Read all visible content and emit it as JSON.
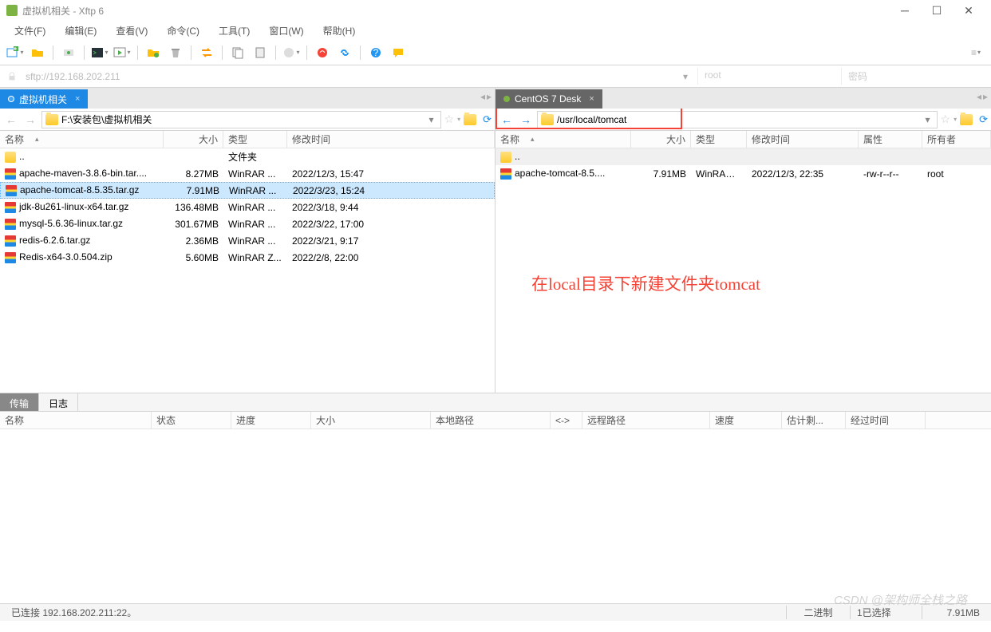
{
  "title": "虚拟机相关 - Xftp 6",
  "menus": [
    "文件(F)",
    "编辑(E)",
    "查看(V)",
    "命令(C)",
    "工具(T)",
    "窗口(W)",
    "帮助(H)"
  ],
  "address": {
    "url": "sftp://192.168.202.211",
    "user": "root",
    "password_placeholder": "密码"
  },
  "left": {
    "tab": "虚拟机相关",
    "path": "F:\\安装包\\虚拟机相关",
    "headers": {
      "name": "名称",
      "size": "大小",
      "type": "类型",
      "mtime": "修改时间"
    },
    "parent": {
      "name": "..",
      "type": "文件夹"
    },
    "rows": [
      {
        "name": "apache-maven-3.8.6-bin.tar....",
        "size": "8.27MB",
        "type": "WinRAR ...",
        "mtime": "2022/12/3, 15:47",
        "icon": "archive"
      },
      {
        "name": "apache-tomcat-8.5.35.tar.gz",
        "size": "7.91MB",
        "type": "WinRAR ...",
        "mtime": "2022/3/23, 15:24",
        "icon": "archive",
        "selected": true
      },
      {
        "name": "jdk-8u261-linux-x64.tar.gz",
        "size": "136.48MB",
        "type": "WinRAR ...",
        "mtime": "2022/3/18, 9:44",
        "icon": "archive"
      },
      {
        "name": "mysql-5.6.36-linux.tar.gz",
        "size": "301.67MB",
        "type": "WinRAR ...",
        "mtime": "2022/3/22, 17:00",
        "icon": "archive"
      },
      {
        "name": "redis-6.2.6.tar.gz",
        "size": "2.36MB",
        "type": "WinRAR ...",
        "mtime": "2022/3/21, 9:17",
        "icon": "archive"
      },
      {
        "name": "Redis-x64-3.0.504.zip",
        "size": "5.60MB",
        "type": "WinRAR Z...",
        "mtime": "2022/2/8, 22:00",
        "icon": "zip"
      }
    ]
  },
  "right": {
    "tab": "CentOS 7 Desk",
    "path": "/usr/local/tomcat",
    "headers": {
      "name": "名称",
      "size": "大小",
      "type": "类型",
      "mtime": "修改时间",
      "attr": "属性",
      "owner": "所有者"
    },
    "parent": {
      "name": ".."
    },
    "rows": [
      {
        "name": "apache-tomcat-8.5....",
        "size": "7.91MB",
        "type": "WinRAR ...",
        "mtime": "2022/12/3, 22:35",
        "attr": "-rw-r--r--",
        "owner": "root",
        "icon": "archive"
      }
    ]
  },
  "annotation": "在local目录下新建文件夹tomcat",
  "bottom_tabs": {
    "transfer": "传输",
    "log": "日志"
  },
  "transfer_headers": [
    "名称",
    "状态",
    "进度",
    "大小",
    "本地路径",
    "<->",
    "远程路径",
    "速度",
    "估计剩...",
    "经过时间"
  ],
  "status": {
    "conn": "已连接 192.168.202.211:22。",
    "mode": "二进制",
    "sel": "1已选择",
    "size": "7.91MB"
  },
  "watermark": "CSDN @架构师全栈之路"
}
